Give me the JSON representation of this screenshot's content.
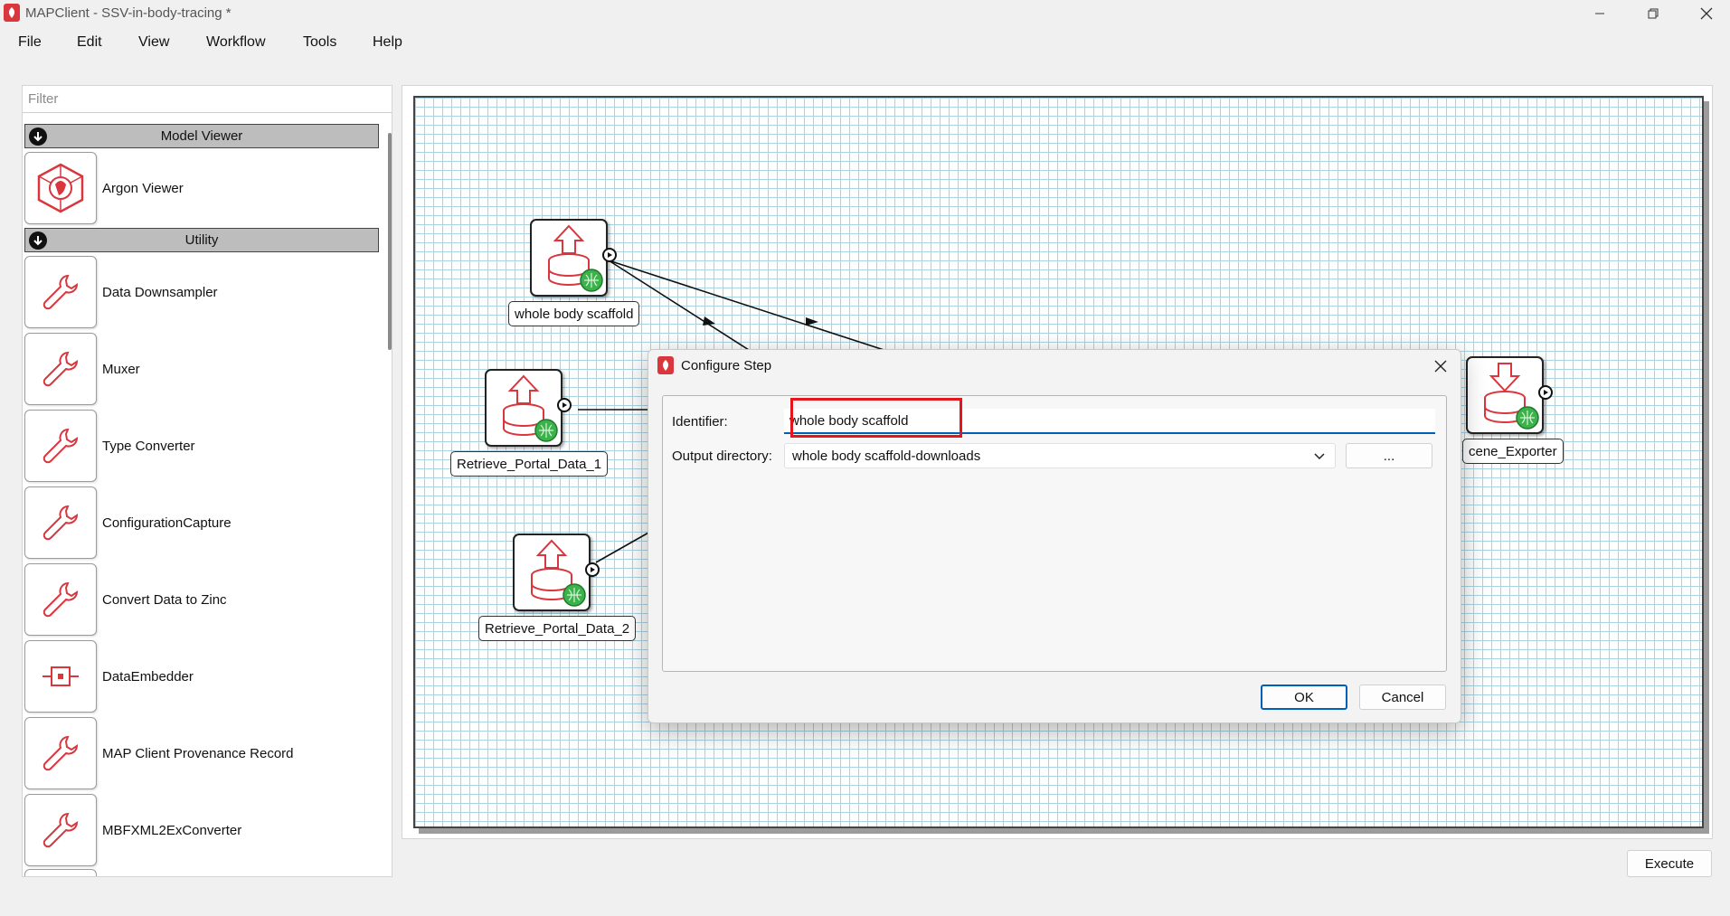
{
  "window": {
    "title": "MAPClient - SSV-in-body-tracing *"
  },
  "menu": [
    "File",
    "Edit",
    "View",
    "Workflow",
    "Tools",
    "Help"
  ],
  "left_panel": {
    "filter_placeholder": "Filter",
    "groups": [
      {
        "name": "Model Viewer",
        "plugins": [
          {
            "label": "Argon Viewer",
            "icon": "argon-viewer-icon"
          }
        ]
      },
      {
        "name": "Utility",
        "plugins": [
          {
            "label": "Data Downsampler",
            "icon": "wrench-icon"
          },
          {
            "label": "Muxer",
            "icon": "wrench-icon"
          },
          {
            "label": "Type Converter",
            "icon": "wrench-icon"
          },
          {
            "label": "ConfigurationCapture",
            "icon": "wrench-icon"
          },
          {
            "label": "Convert Data to Zinc",
            "icon": "wrench-icon"
          },
          {
            "label": "DataEmbedder",
            "icon": "embedder-icon"
          },
          {
            "label": "MAP Client Provenance Record",
            "icon": "wrench-icon"
          },
          {
            "label": "MBFXML2ExConverter",
            "icon": "wrench-icon"
          }
        ]
      }
    ]
  },
  "canvas": {
    "nodes": [
      {
        "label": "whole body scaffold",
        "icon": "upload-database-icon"
      },
      {
        "label": "Retrieve_Portal_Data_1",
        "icon": "upload-database-icon"
      },
      {
        "label": "Retrieve_Portal_Data_2",
        "icon": "upload-database-icon"
      },
      {
        "label": "cene_Exporter",
        "icon": "download-database-icon"
      }
    ]
  },
  "dialog": {
    "title": "Configure Step",
    "identifier_label": "Identifier:",
    "identifier_value": "whole body scaffold",
    "output_dir_label": "Output directory:",
    "output_dir_value": "whole body scaffold-downloads",
    "browse_label": "...",
    "ok_label": "OK",
    "cancel_label": "Cancel"
  },
  "footer": {
    "execute_label": "Execute"
  },
  "colors": {
    "accent": "#005fb8",
    "highlight": "#e5151c",
    "brand": "#d9363e",
    "grid": "#a9d2e3"
  }
}
